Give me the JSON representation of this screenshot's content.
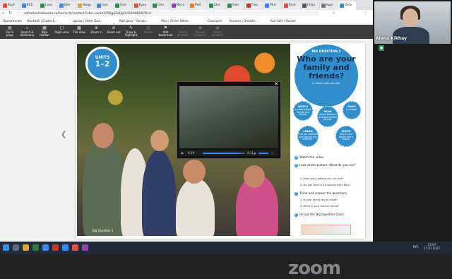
{
  "browser": {
    "tabs": [
      {
        "label": "Kayf"
      },
      {
        "label": "ВСЕ"
      },
      {
        "label": "Lrea"
      },
      {
        "label": "Gler"
      },
      {
        "label": "Видр"
      },
      {
        "label": "Goo"
      },
      {
        "label": "Gler"
      },
      {
        "label": "Kypo"
      },
      {
        "label": "Gler"
      },
      {
        "label": "Мого"
      },
      {
        "label": "Реll"
      },
      {
        "label": "Gler"
      },
      {
        "label": "Gler"
      },
      {
        "label": "Trav"
      },
      {
        "label": "Mrrr"
      },
      {
        "label": "Shar"
      },
      {
        "label": "https"
      },
      {
        "label": "Appr"
      },
      {
        "label": "Oxfo"
      }
    ],
    "url": "oxfordonlinebooks.ru/home/#/content?isbn=oxhd7258jpj2oQg/4424486087814",
    "bookmarks": [
      "Приложения",
      "Wordwall | Create b...",
      "quizizz | Other Qua...",
      "Мой диск – Google...",
      "Miro | Online White...",
      "Classroom",
      "Kocaeru | Онлайн...",
      "Your Sets | Quizlet"
    ]
  },
  "toolbar": {
    "items": [
      {
        "label": "Go to page",
        "icon": "page-icon",
        "enabled": true
      },
      {
        "label": "Search & dictionary",
        "icon": "search-icon",
        "enabled": true
      },
      {
        "label": "New toolbar",
        "icon": "toolbar-icon",
        "enabled": true
      },
      {
        "label": "Page view",
        "icon": "page-view-icon",
        "enabled": true
      },
      {
        "label": "Tile view",
        "icon": "tile-view-icon",
        "enabled": true
      },
      {
        "label": "Zoom in",
        "icon": "zoom-in-icon",
        "enabled": true
      },
      {
        "label": "Zoom out",
        "icon": "zoom-out-icon",
        "enabled": true
      },
      {
        "label": "Draw & highlight",
        "icon": "pen-icon",
        "enabled": true
      },
      {
        "label": "Notes",
        "icon": "notes-icon",
        "enabled": false
      },
      {
        "label": "Add bookmark",
        "icon": "bookmark-icon",
        "enabled": true
      },
      {
        "label": "Check answers",
        "icon": "check-icon",
        "enabled": false
      },
      {
        "label": "Reveal answers",
        "icon": "reveal-icon",
        "enabled": false
      },
      {
        "label": "Select answers",
        "icon": "select-icon",
        "enabled": false
      }
    ]
  },
  "page": {
    "units_label": "UNITS",
    "units_range": "1–2",
    "caption": "Big Question 1",
    "big_question_label": "BIG QUESTION 1",
    "big_question_title": "Who are your family and friends?",
    "big_question_sub": "In these units you will:",
    "bubbles": [
      {
        "verb": "WATCH",
        "text": "a video about family and friends."
      },
      {
        "verb": "READ",
        "text": "about families and two animal friends."
      },
      {
        "verb": "MAKE",
        "text": "a collage."
      },
      {
        "verb": "LEARN",
        "text": "that our families and friends are different."
      },
      {
        "verb": "WRITE",
        "text": "about your family and a friend."
      }
    ],
    "steps": [
      {
        "letter": "A",
        "text": "Watch the video."
      },
      {
        "letter": "B",
        "text": "Look at the picture. What do you see?"
      },
      {
        "letter": "C",
        "text": "Think and answer the questions."
      },
      {
        "letter": "D",
        "text": "Fill out the Big Question Chart."
      }
    ],
    "questions_b": [
      "How many people can you see?",
      "Do you think it's a special day? Why?"
    ],
    "questions_c": [
      "Is your family big or small?",
      "What is your friend's name?"
    ]
  },
  "video": {
    "current_time": "0:19",
    "duration": "0:11",
    "progress": 0.9
  },
  "participant": {
    "name": "Alena Kikhay"
  },
  "zoom_watermark": "zoom",
  "tray": {
    "lang": "РУС",
    "time": "23:07",
    "date": "17.01.2022"
  },
  "colors": {
    "accent": "#2f8ecb",
    "title_dark": "#1a2b55"
  }
}
